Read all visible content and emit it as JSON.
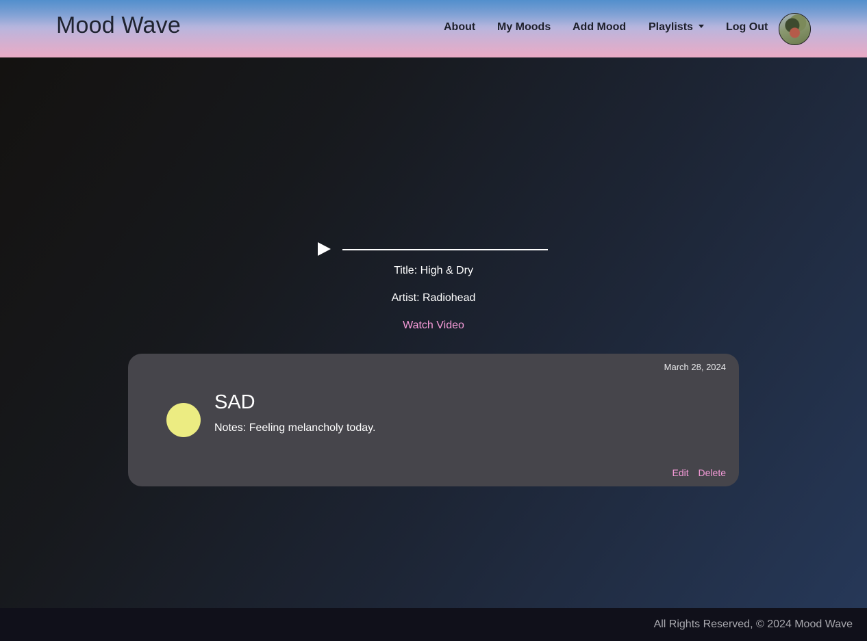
{
  "header": {
    "brand": "Mood Wave",
    "nav": {
      "about": "About",
      "my_moods": "My Moods",
      "add_mood": "Add Mood",
      "playlists": "Playlists",
      "log_out": "Log Out"
    },
    "avatar_icon": "user-avatar"
  },
  "player": {
    "play_icon": "play-icon",
    "progress": 0,
    "title_line": "Title: High & Dry",
    "artist_line": "Artist: Radiohead",
    "watch_link": "Watch Video"
  },
  "mood_card": {
    "date": "March 28, 2024",
    "mood": "SAD",
    "mood_color": "#ecec82",
    "notes": "Notes: Feeling melancholy today.",
    "edit_label": "Edit",
    "delete_label": "Delete"
  },
  "footer": {
    "text": "All Rights Reserved, © 2024 Mood Wave"
  },
  "colors": {
    "accent_link": "#f59bd8",
    "card_bg": "#46454b",
    "footer_bg": "#10101a"
  }
}
